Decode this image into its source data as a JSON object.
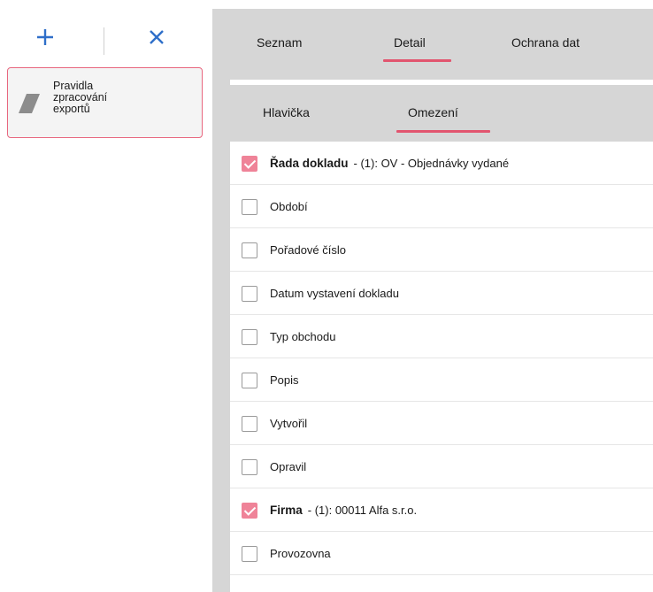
{
  "toolbar": {
    "add_icon": "plus-icon",
    "delete_icon": "close-icon",
    "accent": "#2f6fc9"
  },
  "sidebar": {
    "items": [
      {
        "label": "Pravidla\nzpracování\nexportů",
        "icon": "document-shape-icon"
      }
    ]
  },
  "tabs": {
    "items": [
      {
        "label": "Seznam",
        "selected": false
      },
      {
        "label": "Detail",
        "selected": true
      },
      {
        "label": "Ochrana dat",
        "selected": false
      }
    ]
  },
  "subtabs": {
    "items": [
      {
        "label": "Hlavička",
        "selected": false
      },
      {
        "label": "Omezení",
        "selected": true
      }
    ]
  },
  "filters": {
    "rows": [
      {
        "label": "Řada dokladu",
        "value": "- (1): OV - Objednávky vydané",
        "checked": true
      },
      {
        "label": "Období",
        "value": "",
        "checked": false
      },
      {
        "label": "Pořadové číslo",
        "value": "",
        "checked": false
      },
      {
        "label": "Datum vystavení dokladu",
        "value": "",
        "checked": false
      },
      {
        "label": "Typ obchodu",
        "value": "",
        "checked": false
      },
      {
        "label": "Popis",
        "value": "",
        "checked": false
      },
      {
        "label": "Vytvořil",
        "value": "",
        "checked": false
      },
      {
        "label": "Opravil",
        "value": "",
        "checked": false
      },
      {
        "label": "Firma",
        "value": "- (1): 00011 Alfa s.r.o.",
        "checked": true
      },
      {
        "label": "Provozovna",
        "value": "",
        "checked": false
      }
    ]
  },
  "colors": {
    "accent_pink": "#e2556f",
    "checkbox_checked": "#ef8398",
    "panel_gray": "#d6d6d6"
  }
}
